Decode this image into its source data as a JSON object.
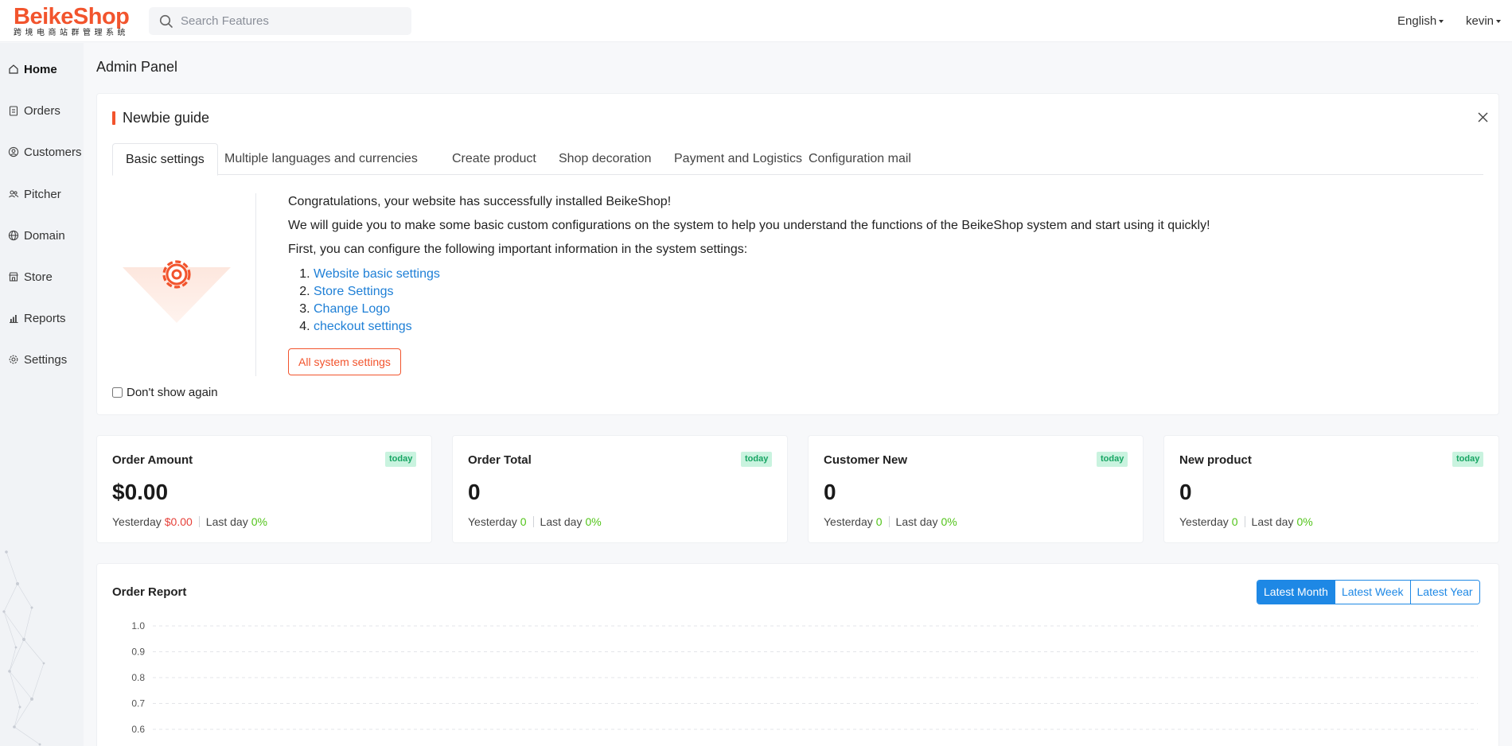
{
  "header": {
    "logo_text": "BeikeShop",
    "logo_subtitle": "跨境电商站群管理系统",
    "search_placeholder": "Search Features",
    "language": "English",
    "user": "kevin"
  },
  "sidebar": {
    "items": [
      {
        "label": "Home",
        "icon": "home-icon",
        "active": true
      },
      {
        "label": "Orders",
        "icon": "clipboard-icon"
      },
      {
        "label": "Customers",
        "icon": "user-circle-icon"
      },
      {
        "label": "Pitcher",
        "icon": "users-icon"
      },
      {
        "label": "Domain",
        "icon": "globe-icon"
      },
      {
        "label": "Store",
        "icon": "store-icon"
      },
      {
        "label": "Reports",
        "icon": "bar-chart-icon"
      },
      {
        "label": "Settings",
        "icon": "gear-icon"
      }
    ]
  },
  "page": {
    "title": "Admin Panel"
  },
  "guide": {
    "title": "Newbie guide",
    "tabs": [
      "Basic settings",
      "Multiple languages and currencies",
      "Create product",
      "Shop decoration",
      "Payment and Logistics",
      "Configuration mail"
    ],
    "paragraphs": [
      "Congratulations, your website has successfully installed BeikeShop!",
      "We will guide you to make some basic custom configurations on the system to help you understand the functions of the BeikeShop system and start using it quickly!",
      "First, you can configure the following important information in the system settings:"
    ],
    "links": [
      "Website basic settings",
      "Store Settings",
      "Change Logo",
      "checkout settings"
    ],
    "button": "All system settings",
    "dont_show": "Don't show again",
    "accent_color": "#f2542d"
  },
  "stats": [
    {
      "title": "Order Amount",
      "badge": "today",
      "value": "$0.00",
      "yesterday_label": "Yesterday",
      "yesterday": "$0.00",
      "lastday_label": "Last day",
      "lastday": "0%"
    },
    {
      "title": "Order Total",
      "badge": "today",
      "value": "0",
      "yesterday_label": "Yesterday",
      "yesterday": "0",
      "lastday_label": "Last day",
      "lastday": "0%"
    },
    {
      "title": "Customer New",
      "badge": "today",
      "value": "0",
      "yesterday_label": "Yesterday",
      "yesterday": "0",
      "lastday_label": "Last day",
      "lastday": "0%"
    },
    {
      "title": "New product",
      "badge": "today",
      "value": "0",
      "yesterday_label": "Yesterday",
      "yesterday": "0",
      "lastday_label": "Last day",
      "lastday": "0%"
    }
  ],
  "report": {
    "title": "Order Report",
    "ranges": [
      "Latest Month",
      "Latest Week",
      "Latest Year"
    ],
    "active_range": "Latest Month"
  },
  "chart_data": {
    "type": "line",
    "title": "",
    "y_ticks": [
      "1.0",
      "0.9",
      "0.8",
      "0.7",
      "0.6"
    ],
    "ylim": [
      0.6,
      1.0
    ],
    "grid": true,
    "series": []
  }
}
